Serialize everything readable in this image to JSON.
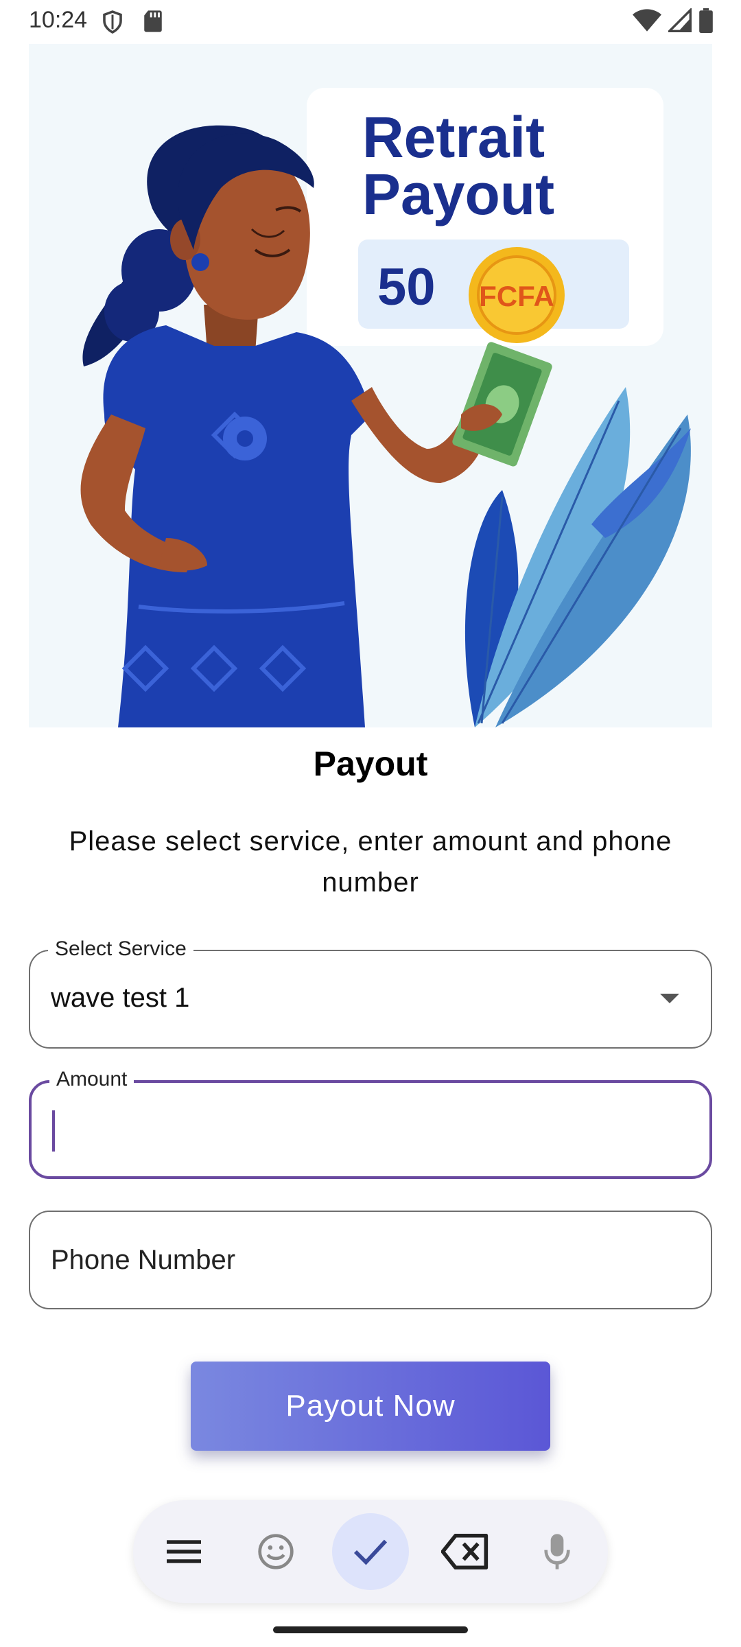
{
  "status_bar": {
    "time": "10:24"
  },
  "hero": {
    "card_title_line1": "Retrait",
    "card_title_line2": "Payout",
    "card_amount": "50",
    "coin_text": "FCFA",
    "colors": {
      "brand_blue": "#1a2f8e",
      "dress": "#1c3fb0",
      "leaf": "#4c8ec9"
    }
  },
  "page": {
    "title": "Payout",
    "subtitle": "Please select service, enter amount and phone number"
  },
  "form": {
    "service": {
      "label": "Select Service",
      "value": "wave test 1"
    },
    "amount": {
      "label": "Amount",
      "value": ""
    },
    "phone": {
      "placeholder": "Phone Number"
    }
  },
  "button": {
    "label": "Payout Now"
  },
  "keyboard_toolbar": {
    "icons": [
      "menu-icon",
      "emoji-icon",
      "check-icon",
      "backspace-icon",
      "mic-icon"
    ]
  },
  "colors": {
    "accent": "#6a4aa0",
    "button_start": "#7a88e0",
    "button_end": "#5b57d6"
  }
}
